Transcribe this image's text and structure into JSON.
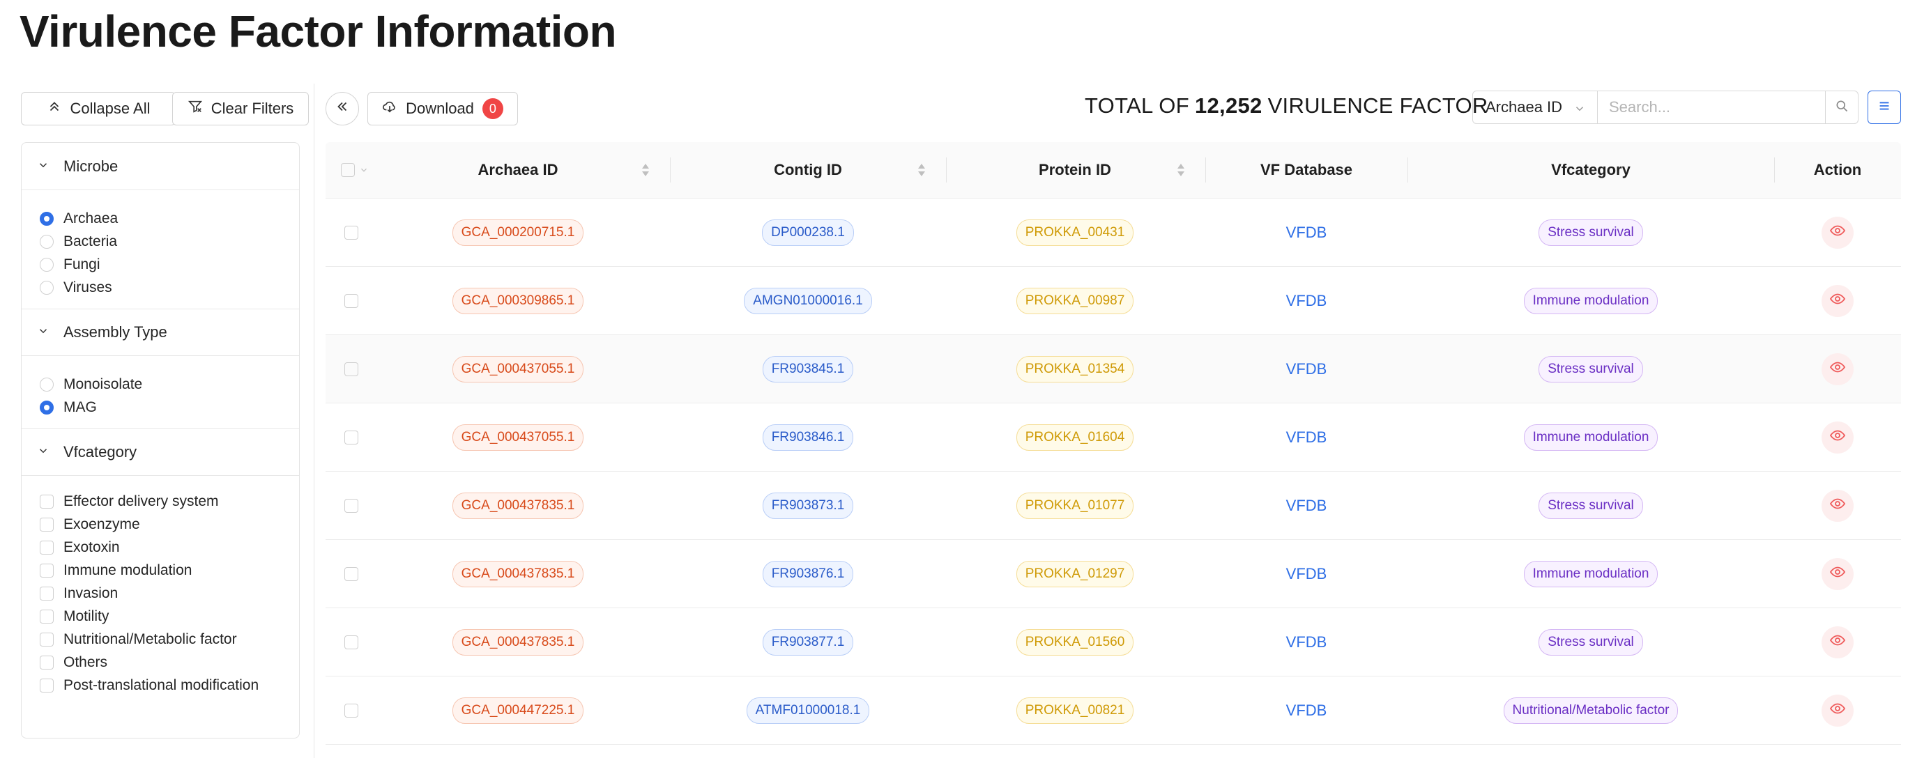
{
  "page_title": "Virulence Factor Information",
  "toolbar": {
    "collapse_label": "Collapse All",
    "clear_label": "Clear Filters",
    "download_label": "Download",
    "download_count": "0",
    "total_prefix": "TOTAL OF",
    "total_count": "12,252",
    "total_suffix": "VIRULENCE FACTOR",
    "search_field": "Archaea ID",
    "search_placeholder": "Search..."
  },
  "filters": {
    "microbe": {
      "title": "Microbe",
      "options": [
        "Archaea",
        "Bacteria",
        "Fungi",
        "Viruses"
      ],
      "selected": "Archaea"
    },
    "assembly": {
      "title": "Assembly Type",
      "options": [
        "Monoisolate",
        "MAG"
      ],
      "selected": "MAG"
    },
    "vfcategory": {
      "title": "Vfcategory",
      "options": [
        "Effector delivery system",
        "Exoenzyme",
        "Exotoxin",
        "Immune modulation",
        "Invasion",
        "Motility",
        "Nutritional/Metabolic factor",
        "Others",
        "Post-translational modification"
      ]
    }
  },
  "table": {
    "columns": [
      "Archaea ID",
      "Contig ID",
      "Protein ID",
      "VF Database",
      "Vfcategory",
      "Action"
    ],
    "rows": [
      {
        "archaea": "GCA_000200715.1",
        "contig": "DP000238.1",
        "protein": "PROKKA_00431",
        "db": "VFDB",
        "category": "Stress survival"
      },
      {
        "archaea": "GCA_000309865.1",
        "contig": "AMGN01000016.1",
        "protein": "PROKKA_00987",
        "db": "VFDB",
        "category": "Immune modulation"
      },
      {
        "archaea": "GCA_000437055.1",
        "contig": "FR903845.1",
        "protein": "PROKKA_01354",
        "db": "VFDB",
        "category": "Stress survival"
      },
      {
        "archaea": "GCA_000437055.1",
        "contig": "FR903846.1",
        "protein": "PROKKA_01604",
        "db": "VFDB",
        "category": "Immune modulation"
      },
      {
        "archaea": "GCA_000437835.1",
        "contig": "FR903873.1",
        "protein": "PROKKA_01077",
        "db": "VFDB",
        "category": "Stress survival"
      },
      {
        "archaea": "GCA_000437835.1",
        "contig": "FR903876.1",
        "protein": "PROKKA_01297",
        "db": "VFDB",
        "category": "Immune modulation"
      },
      {
        "archaea": "GCA_000437835.1",
        "contig": "FR903877.1",
        "protein": "PROKKA_01560",
        "db": "VFDB",
        "category": "Stress survival"
      },
      {
        "archaea": "GCA_000447225.1",
        "contig": "ATMF01000018.1",
        "protein": "PROKKA_00821",
        "db": "VFDB",
        "category": "Nutritional/Metabolic factor"
      }
    ]
  },
  "colors": {
    "accent": "#2f6fe6",
    "badge": "#f04545",
    "archaea_tag": "#d84a1a",
    "contig_tag": "#2a5bc9",
    "protein_tag": "#cf9a06",
    "category_tag": "#6a2ec4"
  }
}
